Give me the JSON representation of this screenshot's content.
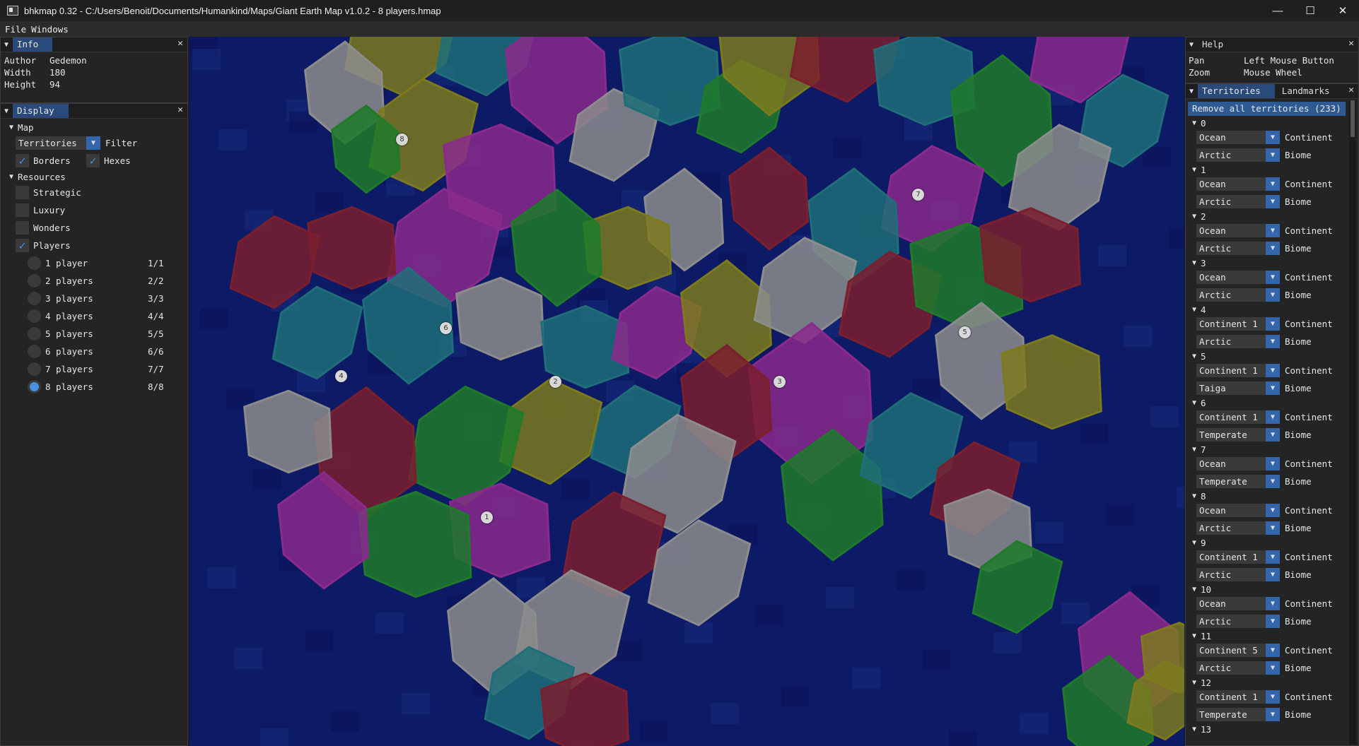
{
  "window": {
    "title": "bhkmap 0.32 - C:/Users/Benoit/Documents/Humankind/Maps/Giant Earth Map v1.0.2 - 8 players.hmap",
    "min": "—",
    "max": "☐",
    "close": "✕"
  },
  "menu": [
    "File",
    "Windows"
  ],
  "info": {
    "tab": "Info",
    "rows": [
      {
        "key": "Author",
        "value": "Gedemon"
      },
      {
        "key": "Width",
        "value": "180"
      },
      {
        "key": "Height",
        "value": "94"
      }
    ]
  },
  "display": {
    "tab": "Display",
    "map_label": "Map",
    "combo_value": "Territories",
    "filter_label": "Filter",
    "borders_label": "Borders",
    "hexes_label": "Hexes",
    "resources_label": "Resources",
    "strategic_label": "Strategic",
    "luxury_label": "Luxury",
    "wonders_label": "Wonders",
    "players_label": "Players",
    "player_options": [
      {
        "label": "1 player",
        "count": "1/1"
      },
      {
        "label": "2 players",
        "count": "2/2"
      },
      {
        "label": "3 players",
        "count": "3/3"
      },
      {
        "label": "4 players",
        "count": "4/4"
      },
      {
        "label": "5 players",
        "count": "5/5"
      },
      {
        "label": "6 players",
        "count": "6/6"
      },
      {
        "label": "7 players",
        "count": "7/7"
      },
      {
        "label": "8 players",
        "count": "8/8"
      }
    ],
    "selected_player_option": 7
  },
  "help": {
    "tab": "Help",
    "rows": [
      {
        "key": "Pan",
        "value": "Left Mouse Button"
      },
      {
        "key": "Zoom",
        "value": "Mouse Wheel"
      }
    ]
  },
  "territories_panel": {
    "tab_active": "Territories",
    "tab_inactive": "Landmarks",
    "remove_button": "Remove all territories (233)",
    "continent_label": "Continent",
    "biome_label": "Biome",
    "items": [
      {
        "id": "0",
        "continent": "Ocean",
        "biome": "Arctic"
      },
      {
        "id": "1",
        "continent": "Ocean",
        "biome": "Arctic"
      },
      {
        "id": "2",
        "continent": "Ocean",
        "biome": "Arctic"
      },
      {
        "id": "3",
        "continent": "Ocean",
        "biome": "Arctic"
      },
      {
        "id": "4",
        "continent": "Continent 1",
        "biome": "Arctic"
      },
      {
        "id": "5",
        "continent": "Continent 1",
        "biome": "Taiga"
      },
      {
        "id": "6",
        "continent": "Continent 1",
        "biome": "Temperate"
      },
      {
        "id": "7",
        "continent": "Ocean",
        "biome": "Temperate"
      },
      {
        "id": "8",
        "continent": "Ocean",
        "biome": "Arctic"
      },
      {
        "id": "9",
        "continent": "Continent 1",
        "biome": "Arctic"
      },
      {
        "id": "10",
        "continent": "Ocean",
        "biome": "Arctic"
      },
      {
        "id": "11",
        "continent": "Continent 5",
        "biome": "Arctic"
      },
      {
        "id": "12",
        "continent": "Continent 1",
        "biome": "Temperate"
      },
      {
        "id": "13",
        "continent": "",
        "biome": ""
      }
    ]
  },
  "map": {
    "ocean_color": "#0d1a66",
    "markers": [
      "8",
      "7",
      "6",
      "5",
      "4",
      "2",
      "3",
      "1"
    ]
  }
}
